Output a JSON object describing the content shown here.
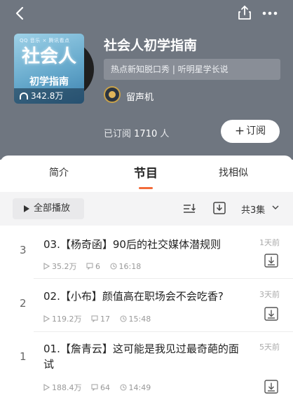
{
  "header": {
    "album_title": "社会人初学指南",
    "tags": "热点新知脱口秀 | 听明星学长说",
    "author": "留声机",
    "subscribed_label": "已订阅",
    "subscribed_count": "1710",
    "subscribed_unit": "人",
    "subscribe_button": "订阅",
    "cover": {
      "brand": "QQ 音乐 × 腾讯看点",
      "title_line1": "社会人",
      "title_line2": "初学指南",
      "plays": "342.8万"
    }
  },
  "tabs": [
    {
      "label": "简介"
    },
    {
      "label": "节目"
    },
    {
      "label": "找相似"
    }
  ],
  "toolbar": {
    "play_all": "全部播放",
    "count": "共3集"
  },
  "episodes": [
    {
      "index": "3",
      "title": "03.【杨奇函】90后的社交媒体潜规则",
      "time": "1天前",
      "plays": "35.2万",
      "comments": "6",
      "duration": "16:18"
    },
    {
      "index": "2",
      "title": "02.【小布】颜值高在职场会不会吃香?",
      "time": "3天前",
      "plays": "119.2万",
      "comments": "17",
      "duration": "15:48"
    },
    {
      "index": "1",
      "title": "01.【詹青云】这可能是我见过最奇葩的面试",
      "time": "5天前",
      "plays": "188.4万",
      "comments": "64",
      "duration": "14:49"
    }
  ],
  "colors": {
    "header_bg": "#6f7680",
    "accent": "#f26b3a"
  }
}
